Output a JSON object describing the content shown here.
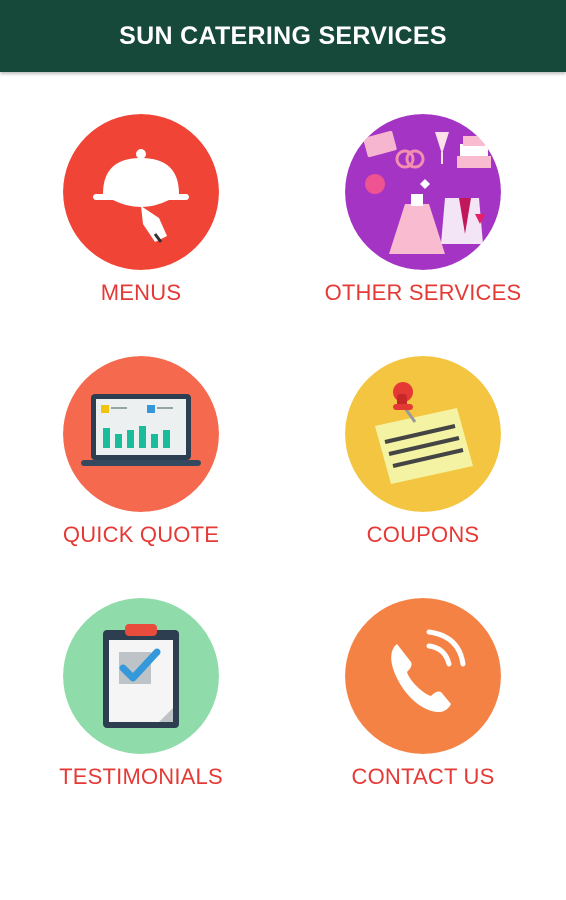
{
  "app": {
    "title": "SUN CATERING SERVICES",
    "header_color": "#17493a"
  },
  "label_color": "#e53935",
  "tiles": [
    {
      "label": "MENUS",
      "icon": "serving-cloche-icon",
      "color": "#ef4436"
    },
    {
      "label": "OTHER SERVICES",
      "icon": "wedding-items-icon",
      "color": "#a334c4"
    },
    {
      "label": "QUICK QUOTE",
      "icon": "laptop-chart-icon",
      "color": "#f5694f"
    },
    {
      "label": "COUPONS",
      "icon": "pinned-note-icon",
      "color": "#f3c540"
    },
    {
      "label": "TESTIMONIALS",
      "icon": "clipboard-check-icon",
      "color": "#8fdbaa"
    },
    {
      "label": "CONTACT US",
      "icon": "phone-icon",
      "color": "#f58245"
    }
  ]
}
